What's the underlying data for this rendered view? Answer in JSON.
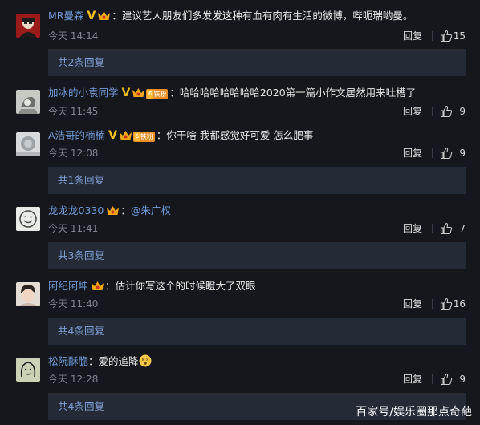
{
  "comments": [
    {
      "username": "MR曼森",
      "text": "建议艺人朋友们多发发这种有血有肉有生活的微博，哔呃瑞哟曼。",
      "time": "今天 14:14",
      "reply_label": "回复",
      "likes": "15",
      "replies_label": "共2条回复",
      "vip": "V",
      "crown": true,
      "fan_badge": false,
      "avatar_icon": "portrait-avatar-icon"
    },
    {
      "username": "加冰的小袁同学",
      "text": "哈哈哈哈哈哈哈哈2020第一篇小作文居然用来吐槽了",
      "time": "今天 11:45",
      "reply_label": "回复",
      "likes": "9",
      "vip": "V",
      "crown": true,
      "fan_badge": true,
      "fan_badge_text": "铁粉",
      "fan_level": "6",
      "avatar_icon": "sketch-avatar-icon"
    },
    {
      "username": "A浩哥的楠楠",
      "text": "你干啥 我都感觉好可爱 怎么肥事",
      "time": "今天 12:08",
      "reply_label": "回复",
      "likes": "9",
      "replies_label": "共1条回复",
      "vip": "V",
      "crown": true,
      "fan_badge": true,
      "fan_badge_text": "铁粉",
      "fan_level": "6",
      "avatar_icon": "photo-avatar-icon"
    },
    {
      "username": "龙龙龙0330",
      "text": "@朱广权",
      "time": "今天 11:41",
      "reply_label": "回复",
      "likes": "7",
      "replies_label": "共3条回复",
      "crown": true,
      "fan_badge": false,
      "avatar_icon": "smiley-avatar-icon"
    },
    {
      "username": "阿纪阿坤",
      "text": "估计你写这个的时候瞪大了双眼",
      "time": "今天 11:40",
      "reply_label": "回复",
      "likes": "16",
      "replies_label": "共4条回复",
      "crown": true,
      "fan_badge": false,
      "avatar_icon": "face-avatar-icon"
    },
    {
      "username": "松阮酥脆",
      "text": "爱的追降",
      "emoji": "dizzy-face-emoji-icon",
      "time": "今天 12:28",
      "reply_label": "回复",
      "likes": "9",
      "replies_label": "共4条回复",
      "crown": false,
      "fan_badge": false,
      "avatar_icon": "drawing-avatar-icon"
    }
  ],
  "watermark": "百家号/娱乐圈那点奇葩",
  "colors": {
    "background": "#15171c",
    "username": "#6f9bd9",
    "reply_bar": "#252a37",
    "reply_bar_text": "#7f9fd4",
    "vip": "#f4c01e",
    "fan_badge": "#e99028"
  }
}
